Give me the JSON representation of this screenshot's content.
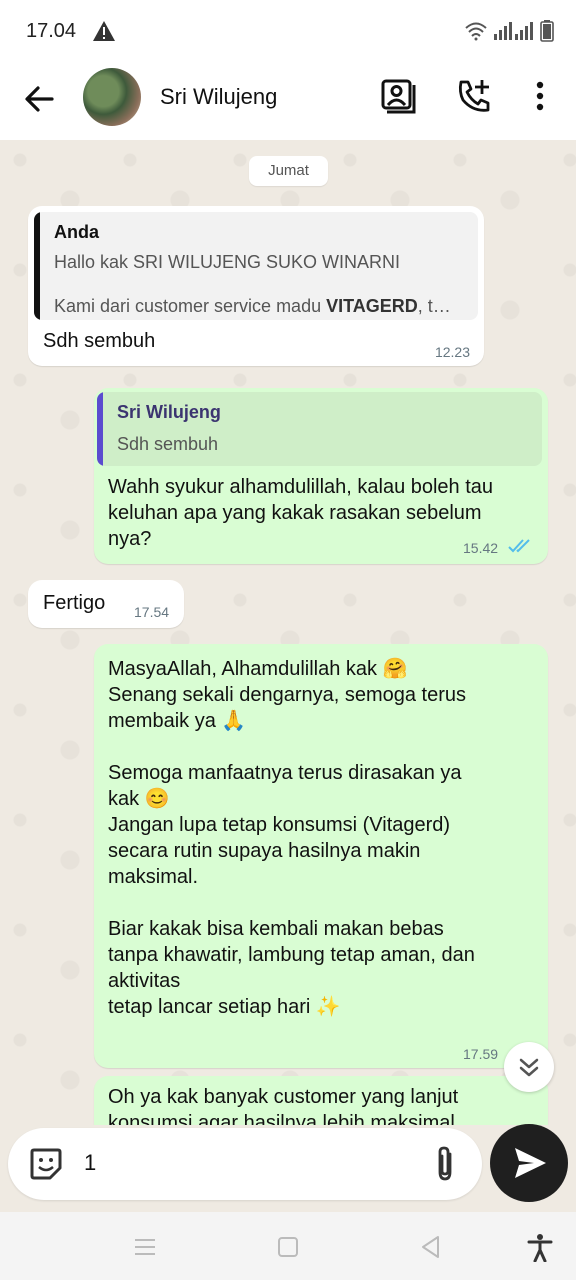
{
  "status": {
    "time": "17.04"
  },
  "header": {
    "contact_name": "Sri Wilujeng"
  },
  "chat": {
    "date_chip": "Jumat",
    "messages": [
      {
        "direction": "in",
        "quote": {
          "author": "Anda",
          "line1": "Hallo kak SRI WILUJENG SUKO WINARNI",
          "line2_prefix": "Kami dari customer service madu ",
          "line2_bold": "VITAGERD",
          "line2_suffix": ", t…"
        },
        "text": "Sdh sembuh",
        "time": "12.23"
      },
      {
        "direction": "out",
        "quote": {
          "author": "Sri Wilujeng",
          "line1": "Sdh sembuh"
        },
        "text_lines": [
          "Wahh syukur alhamdulillah, kalau boleh tau",
          "keluhan apa yang kakak rasakan sebelum",
          "nya?"
        ],
        "time": "15.42"
      },
      {
        "direction": "in",
        "text": "Fertigo",
        "time": "17.54"
      },
      {
        "direction": "out",
        "text_lines": [
          "MasyaAllah, Alhamdulillah kak 🤗",
          "Senang sekali dengarnya, semoga terus",
          "membaik ya 🙏",
          "",
          "Semoga manfaatnya terus dirasakan ya",
          "kak 😊",
          "Jangan lupa tetap konsumsi (Vitagerd)",
          "secara rutin supaya hasilnya makin",
          "maksimal.",
          "",
          "Biar kakak bisa kembali makan bebas",
          "tanpa khawatir, lambung tetap aman, dan",
          "aktivitas",
          "tetap lancar setiap hari ✨"
        ],
        "time": "17.59"
      },
      {
        "direction": "out",
        "text_lines": [
          "Oh ya kak banyak customer yang lanjut",
          "konsumsi agar hasilnya lebih maksimal"
        ]
      }
    ]
  },
  "composer": {
    "value": "1"
  },
  "colors": {
    "outgoing_bubble": "#d9fdd3",
    "incoming_bubble": "#ffffff",
    "quote_bar_me": "#111111",
    "quote_bar_contact": "#5b4ccf",
    "read_tick": "#53bdeb"
  },
  "icons": [
    "warning-icon",
    "wifi-icon",
    "signal-icon",
    "battery-icon",
    "back-icon",
    "contact-card-icon",
    "add-call-icon",
    "more-icon",
    "sticker-icon",
    "attach-icon",
    "send-icon",
    "scroll-down-icon",
    "menu-nav-icon",
    "home-nav-icon",
    "back-nav-icon",
    "accessibility-icon"
  ]
}
